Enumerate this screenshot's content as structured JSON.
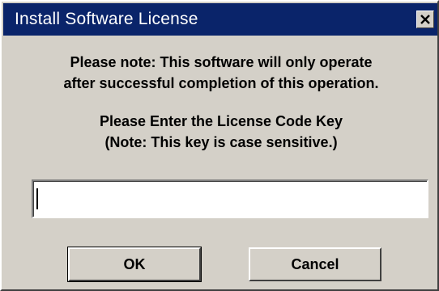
{
  "window": {
    "title": "Install Software License",
    "close_symbol": "×",
    "close_icon": "close-icon",
    "titlebar_color": "#0a246a",
    "face_color": "#d4d0c8"
  },
  "message": {
    "line1": "Please note: This software will only operate",
    "line2": "after successful completion of this operation.",
    "line3": "Please Enter the License Code Key",
    "line4": "(Note: This key is case sensitive.)"
  },
  "license_input": {
    "value": ""
  },
  "buttons": {
    "ok_label": "OK",
    "cancel_label": "Cancel"
  }
}
